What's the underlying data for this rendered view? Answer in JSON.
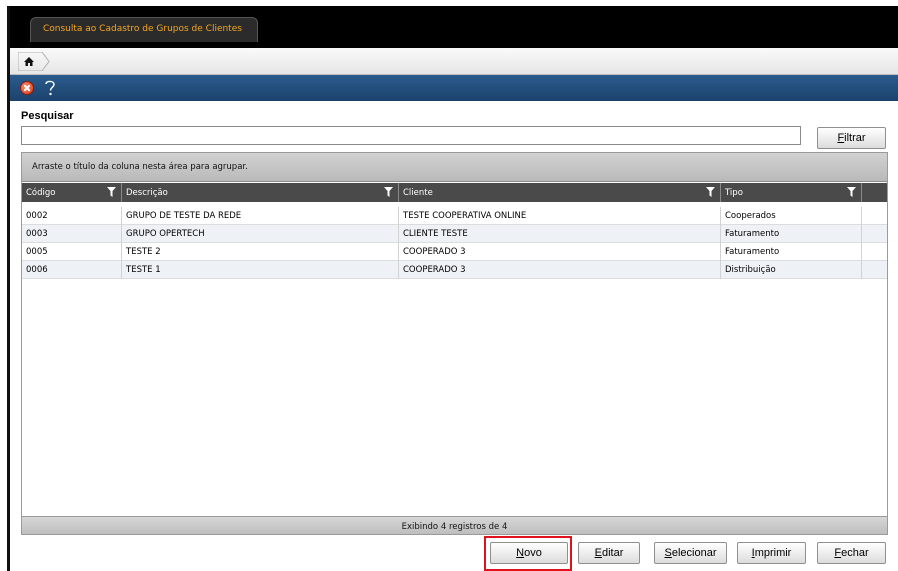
{
  "window": {
    "tab_title": "Consulta ao Cadastro de Grupos de Clientes"
  },
  "breadcrumb": {
    "home_icon": "home-icon"
  },
  "toolbar": {
    "close_icon": "close-circle-icon",
    "help_icon": "help-question-icon"
  },
  "search": {
    "label": "Pesquisar",
    "value": "",
    "filter_prefix": "F",
    "filter_rest": "iltrar"
  },
  "grid": {
    "group_hint": "Arraste o título da coluna nesta área para agrupar.",
    "columns": [
      "Código",
      "Descrição",
      "Cliente",
      "Tipo"
    ],
    "rows": [
      {
        "codigo": "0002",
        "descricao": "GRUPO DE TESTE DA REDE",
        "cliente": "TESTE COOPERATIVA ONLINE",
        "tipo": "Cooperados"
      },
      {
        "codigo": "0003",
        "descricao": "GRUPO OPERTECH",
        "cliente": "CLIENTE TESTE",
        "tipo": "Faturamento"
      },
      {
        "codigo": "0005",
        "descricao": "TESTE 2",
        "cliente": "COOPERADO 3",
        "tipo": "Faturamento"
      },
      {
        "codigo": "0006",
        "descricao": "TESTE 1",
        "cliente": "COOPERADO 3",
        "tipo": "Distribuição"
      }
    ],
    "footer": "Exibindo 4 registros de 4"
  },
  "actions": {
    "novo_prefix": "N",
    "novo_rest": "ovo",
    "editar_prefix": "E",
    "editar_rest": "ditar",
    "selecionar_prefix": "S",
    "selecionar_rest": "elecionar",
    "imprimir_prefix": "I",
    "imprimir_rest": "mprimir",
    "fechar_prefix": "F",
    "fechar_rest": "echar"
  },
  "colors": {
    "tab_text": "#f5a623",
    "toolbar_blue": "#1f4b7a",
    "highlight_red": "#e0121b"
  }
}
